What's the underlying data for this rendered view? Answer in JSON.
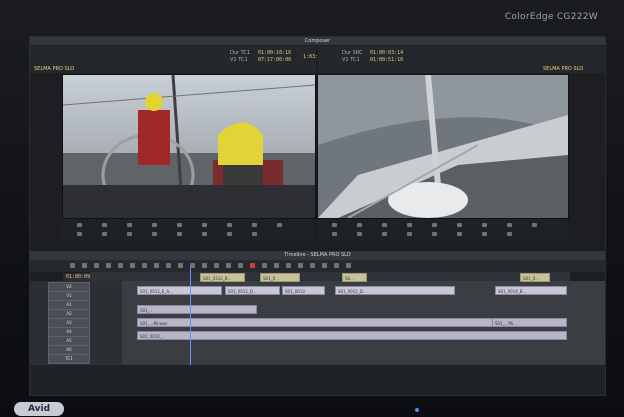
{
  "monitor": {
    "brand": "ColorEdge CG222W",
    "badge": "Avid"
  },
  "composer": {
    "title": "Composer",
    "left_sequence": "SELMA PRO SLO",
    "right_sequence": "SELMA PRO SLO",
    "left_tc_1": "01:00:10:16",
    "left_tc_2": "07:17:00:00",
    "left_lbl_1": "Dur TC1",
    "left_lbl_2": "V1 TC1",
    "center_tc": "1:03:15",
    "right_lbl_1": "Dur SRC",
    "right_lbl_2": "V1 TC1",
    "right_tc_1": "01:00:03:14",
    "right_tc_2": "01:00:51:10"
  },
  "timeline": {
    "title": "Timeline - SELMA PRO SLO",
    "timecode": "01:00:09:16",
    "tracks": [
      "V2",
      "V1",
      "A1",
      "A2",
      "A3",
      "A4",
      "A5",
      "A6",
      "TC1"
    ],
    "clips_v2": [
      "S01_0312_B...",
      "S01_0...",
      "S0...",
      "S01_0..."
    ],
    "clips_v1": [
      "S01_0012_E_A...",
      "S01_0012_D...",
      "S01_0013",
      "S01_0012_D...",
      "S01_0014_B..."
    ],
    "clips_a": [
      "S01_...",
      "S01_...Mi.wav",
      "S01_0012_...",
      "S01_...Mi..."
    ]
  },
  "colors": {
    "accent": "#e9d17a",
    "playhead": "#6f8cff",
    "clip": "#c9c7d6"
  }
}
